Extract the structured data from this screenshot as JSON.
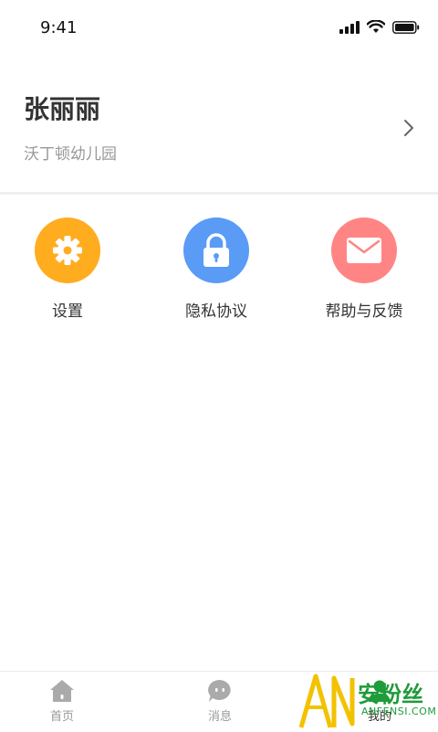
{
  "status_bar": {
    "time": "9:41"
  },
  "profile": {
    "name": "张丽丽",
    "school": "沃丁顿幼儿园"
  },
  "menu": {
    "items": [
      {
        "label": "设置",
        "icon": "gear-icon",
        "color": "#FFAC1F"
      },
      {
        "label": "隐私协议",
        "icon": "lock-icon",
        "color": "#5A9BF5"
      },
      {
        "label": "帮助与反馈",
        "icon": "mail-icon",
        "color": "#FF8585"
      }
    ]
  },
  "tab_bar": {
    "tabs": [
      {
        "label": "首页",
        "icon": "home-icon",
        "active": false
      },
      {
        "label": "消息",
        "icon": "message-icon",
        "active": false
      },
      {
        "label": "我的",
        "icon": "profile-icon",
        "active": true
      }
    ]
  },
  "watermark": {
    "brand": "ANFENSI.COM",
    "text_cn": "安粉丝"
  },
  "colors": {
    "tab_inactive": "#999999",
    "tab_icon_inactive": "#aaaaaa",
    "divider": "#f0f0f2"
  }
}
